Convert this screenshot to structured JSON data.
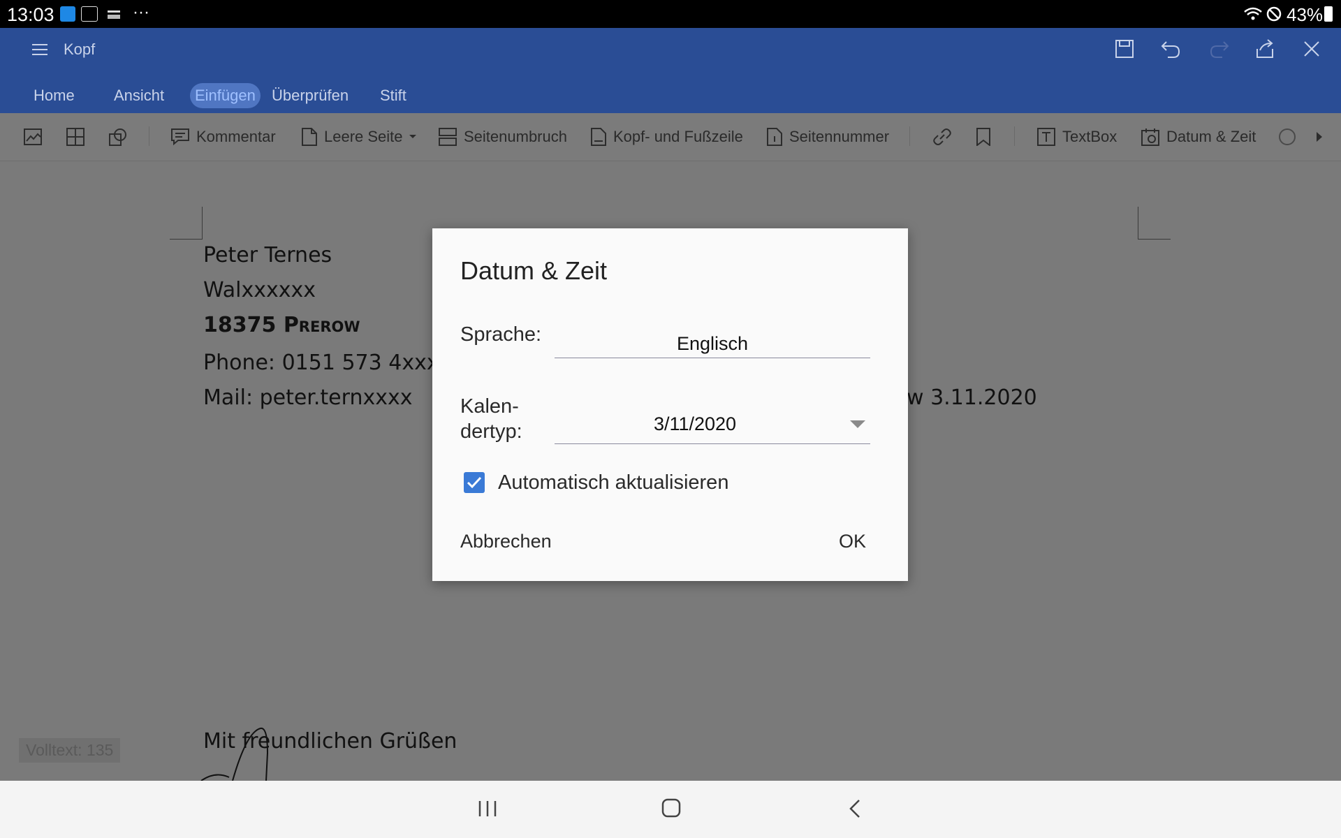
{
  "status_bar": {
    "time": "13:03",
    "battery": "43%",
    "more": "···"
  },
  "app": {
    "doc_title": "Kopf"
  },
  "tabs": [
    {
      "label": "Home",
      "active": false
    },
    {
      "label": "Ansicht",
      "active": false
    },
    {
      "label": "Einfügen",
      "active": true
    },
    {
      "label": "Überprüfen",
      "active": false
    },
    {
      "label": "Stift",
      "active": false
    }
  ],
  "toolbar": {
    "kommentar": "Kommentar",
    "leere_seite": "Leere Seite",
    "seitenumbruch": "Seitenumbruch",
    "kopf_fusszeile": "Kopf- und Fußzeile",
    "seitennummer": "Seitennummer",
    "textbox": "TextBox",
    "datum_zeit": "Datum & Zeit"
  },
  "document": {
    "lines": [
      "Peter Ternes",
      "Walxxxxxx",
      "18375 Prerow",
      "Phone: 0151 573 4xxx",
      "Mail: peter.ternxxxx"
    ],
    "date_right": "w 3.11.2020",
    "closing": "Mit freundlichen Grüßen",
    "word_count": "Volltext: 135"
  },
  "dialog": {
    "title": "Datum & Zeit",
    "language_label": "Sprache:",
    "language_value": "Englisch",
    "calendar_label_1": "Kalen-",
    "calendar_label_2": "dertyp:",
    "calendar_value": "3/11/2020",
    "auto_update_label": "Automatisch aktualisieren",
    "auto_update_checked": true,
    "cancel": "Abbrechen",
    "ok": "OK"
  },
  "colors": {
    "appbar": "#2a4d95",
    "checkbox": "#3a7ad6",
    "active_tab": "#5076c2"
  }
}
